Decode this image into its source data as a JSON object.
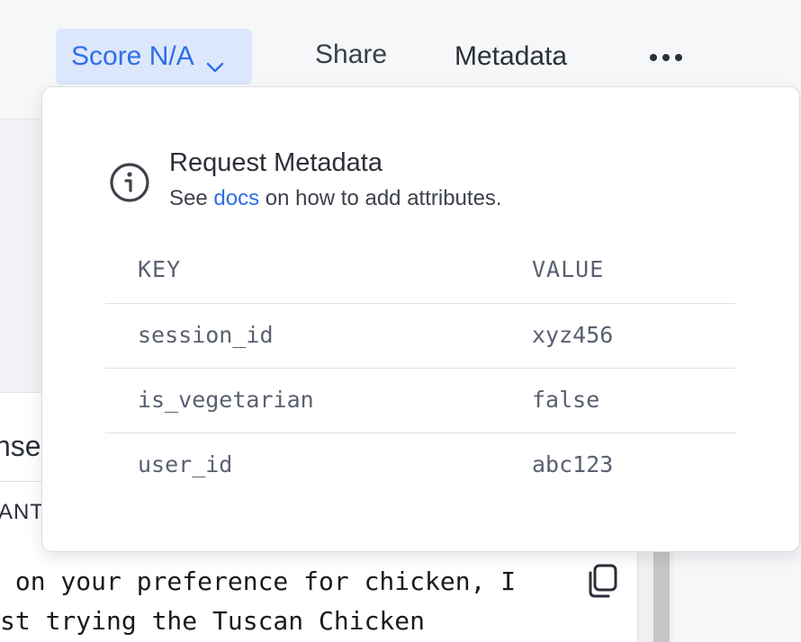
{
  "toolbar": {
    "score_label": "Score N/A",
    "share_label": "Share",
    "metadata_label": "Metadata"
  },
  "background": {
    "section_heading": "nse",
    "role_label": "ANT",
    "message_line1": " on your preference for chicken, I",
    "message_line2": "st trying the Tuscan Chicken"
  },
  "metadata_popover": {
    "title": "Request Metadata",
    "subtitle_prefix": "See ",
    "subtitle_link": "docs",
    "subtitle_suffix": " on how to add attributes.",
    "columns": {
      "key": "KEY",
      "value": "VALUE"
    },
    "rows": [
      {
        "key": "session_id",
        "value": "xyz456"
      },
      {
        "key": "is_vegetarian",
        "value": "false"
      },
      {
        "key": "user_id",
        "value": "abc123"
      }
    ]
  },
  "colors": {
    "accent": "#2f6ee6",
    "accent_bg": "#dce7fb",
    "text": "#2b2f38",
    "muted": "#5a6070"
  }
}
